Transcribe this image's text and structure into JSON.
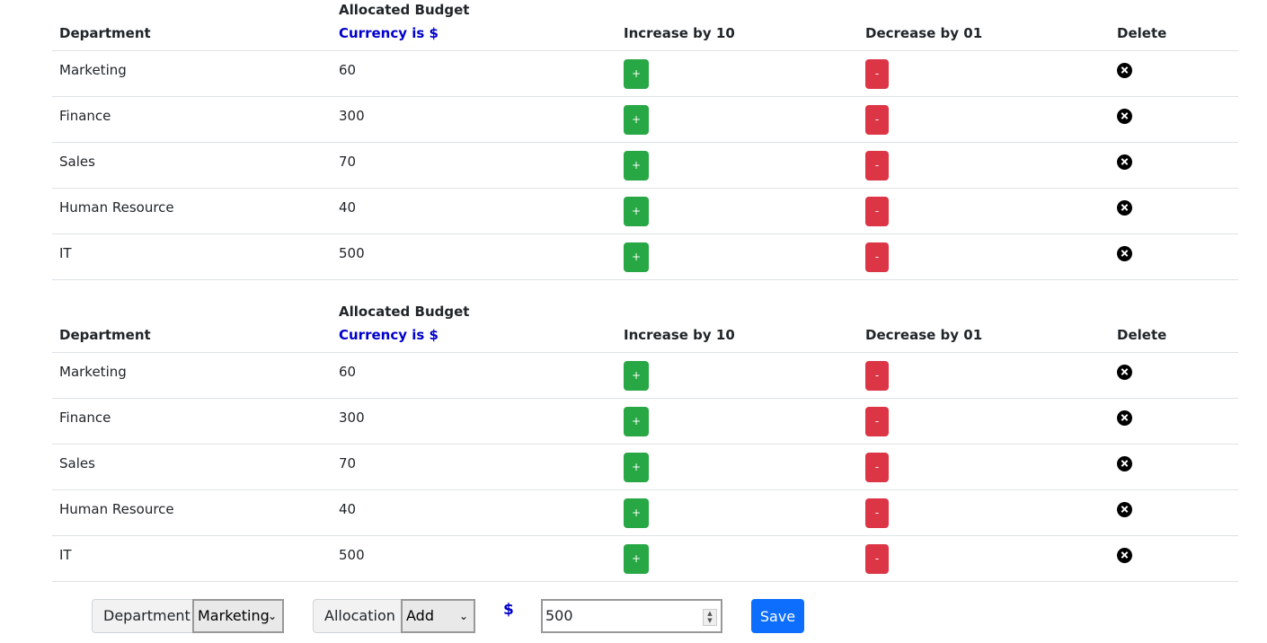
{
  "tables": [
    {
      "headers": {
        "department": "Department",
        "budget": "Allocated Budget",
        "currency": "Currency is $",
        "increase": "Increase by 10",
        "decrease": "Decrease by 01",
        "delete": "Delete"
      },
      "rows": [
        {
          "name": "Marketing",
          "budget": "60",
          "inc": "+",
          "dec": "-"
        },
        {
          "name": "Finance",
          "budget": "300",
          "inc": "+",
          "dec": "-"
        },
        {
          "name": "Sales",
          "budget": "70",
          "inc": "+",
          "dec": "-"
        },
        {
          "name": "Human Resource",
          "budget": "40",
          "inc": "+",
          "dec": "-"
        },
        {
          "name": "IT",
          "budget": "500",
          "inc": "+",
          "dec": "-"
        }
      ]
    },
    {
      "headers": {
        "department": "Department",
        "budget": "Allocated Budget",
        "currency": "Currency is $",
        "increase": "Increase by 10",
        "decrease": "Decrease by 01",
        "delete": "Delete"
      },
      "rows": [
        {
          "name": "Marketing",
          "budget": "60",
          "inc": "+",
          "dec": "-"
        },
        {
          "name": "Finance",
          "budget": "300",
          "inc": "+",
          "dec": "-"
        },
        {
          "name": "Sales",
          "budget": "70",
          "inc": "+",
          "dec": "-"
        },
        {
          "name": "Human Resource",
          "budget": "40",
          "inc": "+",
          "dec": "-"
        },
        {
          "name": "IT",
          "budget": "500",
          "inc": "+",
          "dec": "-"
        }
      ]
    }
  ],
  "form": {
    "department_label": "Department",
    "department_value": "Marketing",
    "allocation_label": "Allocation",
    "allocation_value": "Add",
    "currency_symbol": "$",
    "amount_value": "500",
    "save_label": "Save"
  },
  "colors": {
    "increase": "#28a745",
    "decrease": "#dc3545",
    "save": "#0d6efd",
    "currency_text": "#0000cc"
  },
  "icons": {
    "delete": "close-circle-icon",
    "select": "chevron-down-icon"
  }
}
